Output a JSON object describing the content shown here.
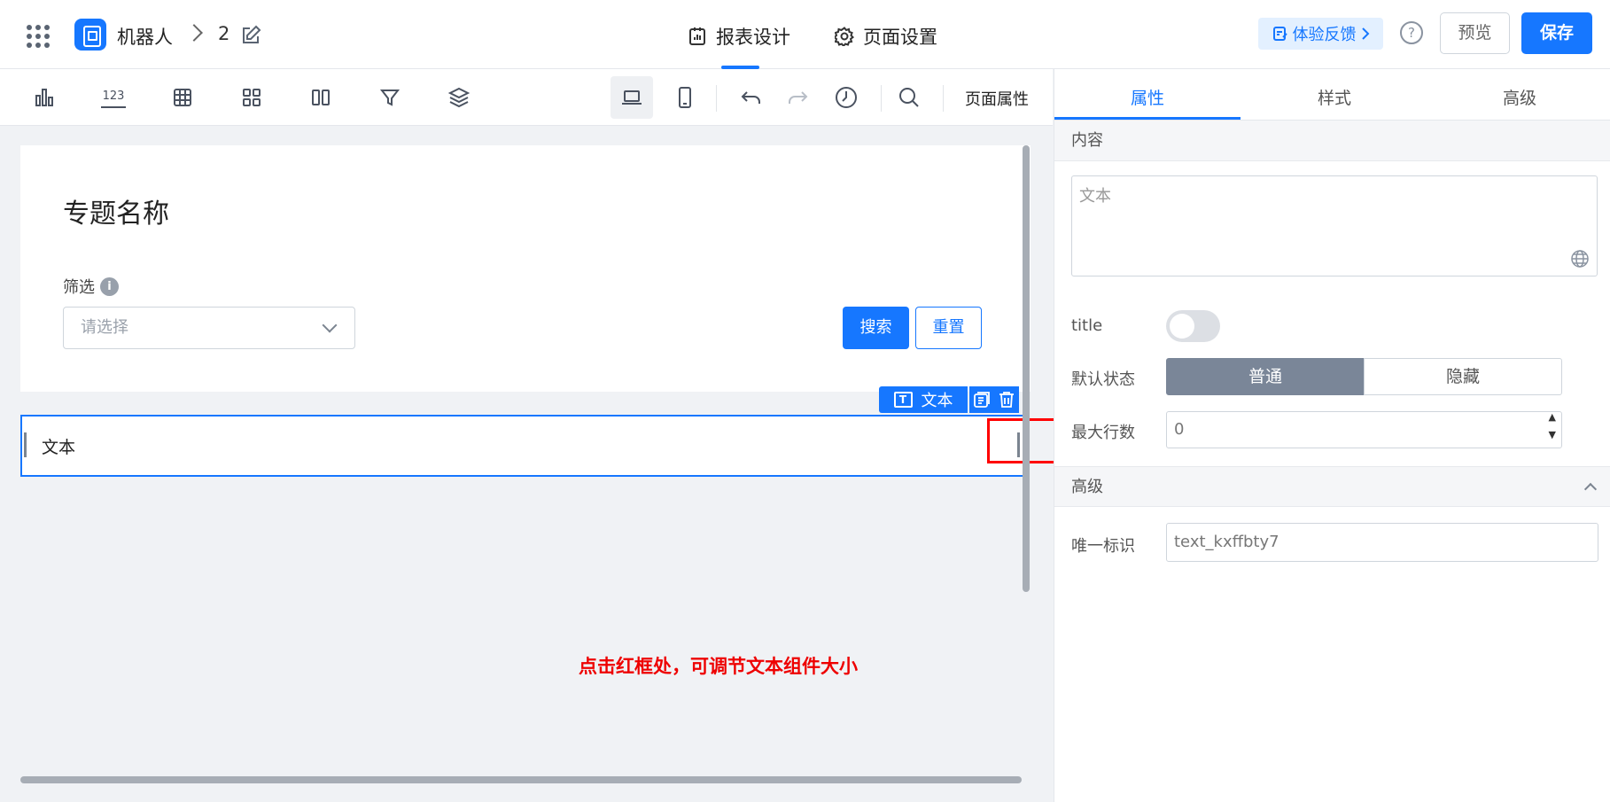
{
  "header": {
    "app_name": "机器人",
    "page_number": "2",
    "tabs": [
      "报表设计",
      "页面设置"
    ],
    "feedback_label": "体验反馈",
    "help_glyph": "?",
    "preview_label": "预览",
    "save_label": "保存"
  },
  "toolbar": {
    "page_properties_label": "页面属性",
    "number_component_glyph": "123",
    "icons": [
      "bar-chart-icon",
      "number-card-icon",
      "table-icon",
      "grid-layout-icon",
      "columns-icon",
      "filter-icon",
      "layers-icon",
      "desktop-view-icon",
      "mobile-view-icon",
      "undo-icon",
      "redo-icon",
      "history-icon",
      "search-icon"
    ]
  },
  "canvas": {
    "topic_title": "专题名称",
    "filter_label": "筛选",
    "info_glyph": "i",
    "select_placeholder": "请选择",
    "search_label": "搜索",
    "reset_label": "重置",
    "component_tag_glyph": "T",
    "component_tag_label": "文本",
    "text_component_value": "文本",
    "hint_text": "点击红框处，可调节文本组件大小"
  },
  "panel": {
    "tabs": [
      "属性",
      "样式",
      "高级"
    ],
    "content_section": "内容",
    "content_placeholder": "文本",
    "title_label": "title",
    "default_state_label": "默认状态",
    "state_options": [
      "普通",
      "隐藏"
    ],
    "max_rows_label": "最大行数",
    "max_rows_value": "0",
    "spin_up": "▲",
    "spin_down": "▼",
    "advanced_section": "高级",
    "unique_id_label": "唯一标识",
    "unique_id_value": "text_kxffbty7"
  },
  "colors": {
    "accent": "#1677ff",
    "hint_red": "#ff0000",
    "segment_active": "#7a8698"
  }
}
